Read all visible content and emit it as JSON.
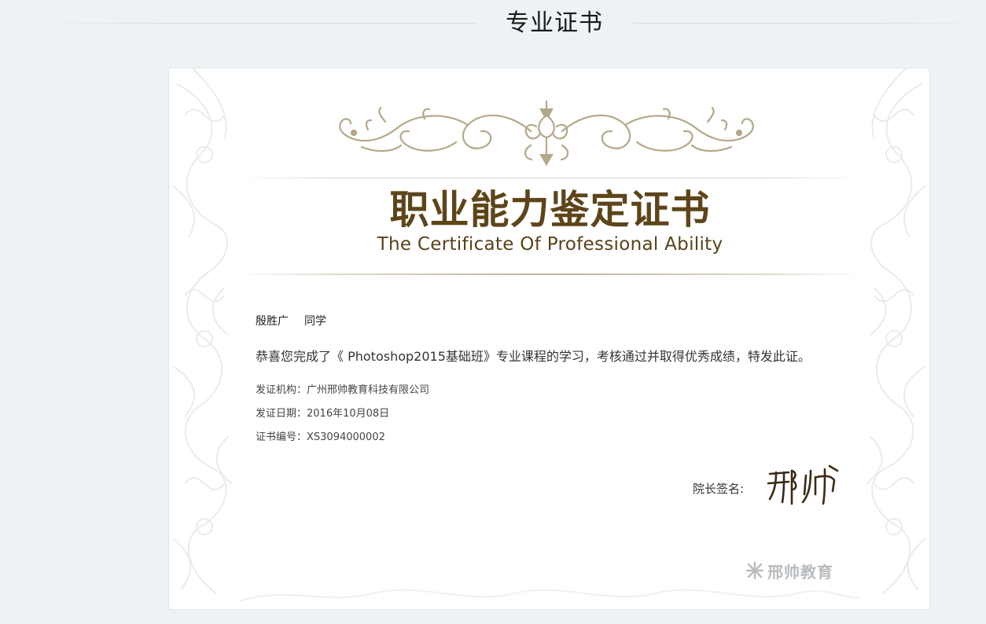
{
  "section": {
    "title": "专业证书"
  },
  "certificate": {
    "title": "职业能力鉴定证书",
    "subtitle": "The Certificate Of Professional Ability",
    "student_name": "殷胜广",
    "student_role": "同学",
    "message": "恭喜您完成了《 Photoshop2015基础班》专业课程的学习，考核通过并取得优秀成绩，特发此证。",
    "issuer": "发证机构：广州邢帅教育科技有限公司",
    "issue_date": "发证日期：2016年10月08日",
    "cert_number": "证书编号：XS3094000002",
    "sign_label": "院长签名:",
    "signature_icon": "dean-signature-icon",
    "watermark": "邢帅教育",
    "watermark_icon": "brand-logo-icon"
  },
  "colors": {
    "background": "#eef2f5",
    "title_brown": "#5e4519",
    "ornament_gold": "#b5a88a"
  }
}
